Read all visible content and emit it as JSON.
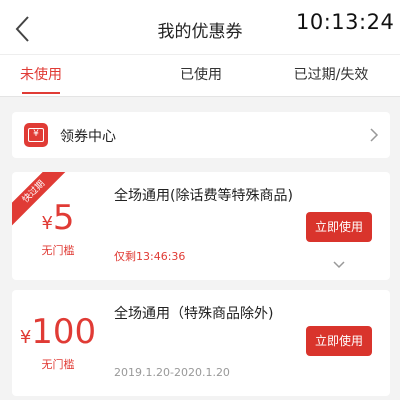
{
  "header": {
    "title": "我的优惠券",
    "clock": "10:13:24"
  },
  "tabs": [
    {
      "label": "未使用",
      "active": true
    },
    {
      "label": "已使用",
      "active": false
    },
    {
      "label": "已过期/失效",
      "active": false
    }
  ],
  "coupon_center": {
    "label": "领券中心",
    "icon": "coupon-ticket-icon",
    "badge_glyph": "¥"
  },
  "coupons": [
    {
      "ribbon": "快过期",
      "currency": "¥",
      "amount": "5",
      "threshold": "无门槛",
      "title": "全场通用(除话费等特殊商品)",
      "subtitle": "仅剩13:46:36",
      "button": "立即使用"
    },
    {
      "currency": "¥",
      "amount": "100",
      "threshold": "无门槛",
      "title": "全场通用（特殊商品除外)",
      "subtitle": "2019.1.20-2020.1.20",
      "button": "立即使用"
    }
  ],
  "colors": {
    "accent": "#e03b35",
    "button": "#d9342c",
    "background": "#f3f3f3",
    "muted_text": "#999999"
  }
}
